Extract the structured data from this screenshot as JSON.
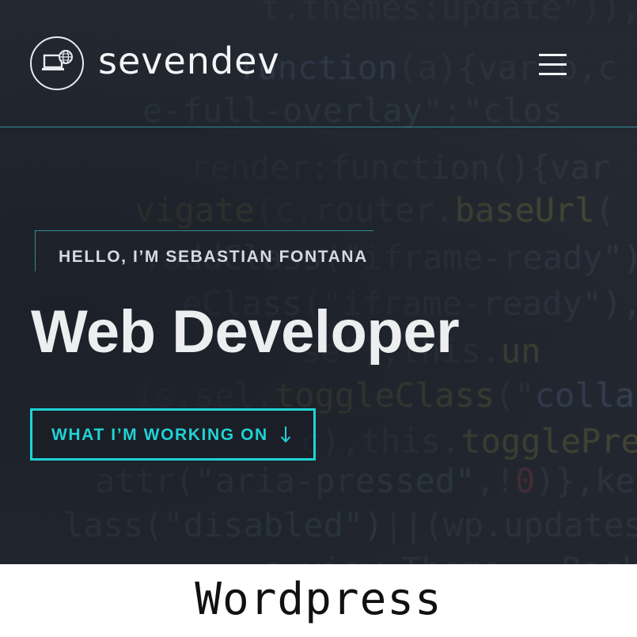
{
  "header": {
    "brand": "sevendev",
    "logo_icon": "laptop-globe-icon",
    "menu_icon": "hamburger-menu-icon"
  },
  "hero": {
    "greeting": "HELLO, I’M SEBASTIAN FONTANA",
    "headline": "Web Developer",
    "cta_label": "WHAT I’M WORKING ON",
    "cta_icon": "arrow-down-icon",
    "background": "code-texture"
  },
  "caption": "Wordpress",
  "colors": {
    "accent": "#1fd3d6",
    "divider": "#2f8d93",
    "background": "#262b33",
    "text": "#eceef0"
  }
}
